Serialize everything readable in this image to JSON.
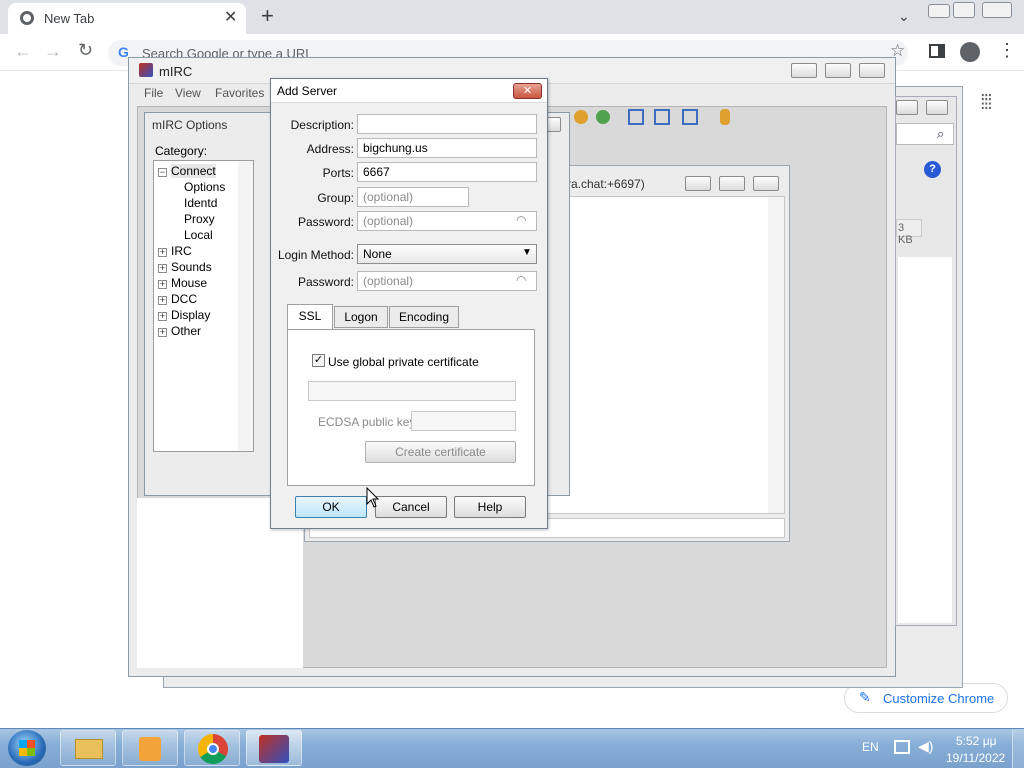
{
  "chrome": {
    "tab_title": "New Tab",
    "new_tab_symbol": "+",
    "omnibox_placeholder": "Search Google or type a URL",
    "customize_label": "Customize Chrome"
  },
  "mirc": {
    "title": "mIRC",
    "menu": [
      "File",
      "View",
      "Favorites"
    ],
    "status_text": "ra.chat:+6697)",
    "kb_badge": "3 KB"
  },
  "options": {
    "title": "mIRC Options",
    "category_label": "Category:",
    "tree": [
      {
        "label": "Connect",
        "expander": "−",
        "level": 0
      },
      {
        "label": "Options",
        "level": 1
      },
      {
        "label": "Identd",
        "level": 1
      },
      {
        "label": "Proxy",
        "level": 1
      },
      {
        "label": "Local",
        "level": 1
      },
      {
        "label": "IRC",
        "expander": "+",
        "level": 0
      },
      {
        "label": "Sounds",
        "expander": "+",
        "level": 0
      },
      {
        "label": "Mouse",
        "expander": "+",
        "level": 0
      },
      {
        "label": "DCC",
        "expander": "+",
        "level": 0
      },
      {
        "label": "Display",
        "expander": "+",
        "level": 0
      },
      {
        "label": "Other",
        "expander": "+",
        "level": 0
      }
    ]
  },
  "add_server": {
    "title": "Add Server",
    "description_label": "Description:",
    "description_value": "",
    "address_label": "Address:",
    "address_value": "bigchung.us",
    "ports_label": "Ports:",
    "ports_value": "6667",
    "group_label": "Group:",
    "group_placeholder": "(optional)",
    "password_label": "Password:",
    "password_placeholder": "(optional)",
    "login_method_label": "Login Method:",
    "login_method_value": "None",
    "password2_label": "Password:",
    "password2_placeholder": "(optional)",
    "tabs": [
      "SSL",
      "Logon",
      "Encoding"
    ],
    "use_global_cert_label": "Use global private certificate",
    "use_global_cert_checked": true,
    "ecdsa_label": "ECDSA public key:",
    "create_cert_label": "Create certificate",
    "ok_label": "OK",
    "cancel_label": "Cancel",
    "help_label": "Help"
  },
  "taskbar": {
    "lang": "EN",
    "time": "5:52 μμ",
    "date": "19/11/2022"
  },
  "colors": {
    "taskbar": "#87aed6",
    "chrome_tabbar": "#dee1e6",
    "customize_accent": "#1a73e8"
  }
}
